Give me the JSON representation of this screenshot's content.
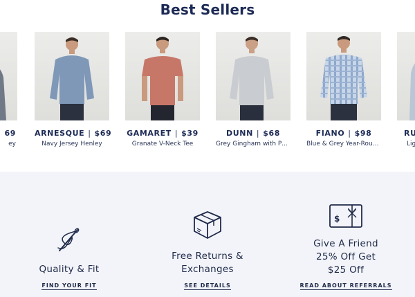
{
  "section_title": "Best Sellers",
  "products": [
    {
      "name": "",
      "price": "69",
      "desc": "ey",
      "shirt": "#6f7a86"
    },
    {
      "name": "ARNESQUE",
      "price": "$69",
      "desc": "Navy Jersey Henley",
      "shirt": "#7f98b8"
    },
    {
      "name": "GAMARET",
      "price": "$39",
      "desc": "Granate V-Neck Tee",
      "shirt": "#c77768"
    },
    {
      "name": "DUNN",
      "price": "$68",
      "desc": "Grey Gingham with Poi...",
      "shirt": "#c9ccd0"
    },
    {
      "name": "FIANO",
      "price": "$98",
      "desc": "Blue & Grey Year-Roun...",
      "shirt": "#a9c1dc"
    },
    {
      "name": "RU",
      "price": "",
      "desc": "Light C",
      "shirt": "#b9c6d6"
    }
  ],
  "promos": [
    {
      "text": "Quality & Fit",
      "link": "FIND YOUR FIT",
      "icon": "needle-thread-icon"
    },
    {
      "text": "Free Returns & Exchanges",
      "link": "SEE DETAILS",
      "icon": "box-icon"
    },
    {
      "text": "Give A Friend 25% Off Get $25 Off",
      "link": "READ ABOUT REFERRALS",
      "icon": "gift-card-icon"
    }
  ],
  "colors": {
    "navy": "#1c2a55",
    "promo_bg": "#f3f4f9",
    "image_bg": "#e6e6e4"
  }
}
